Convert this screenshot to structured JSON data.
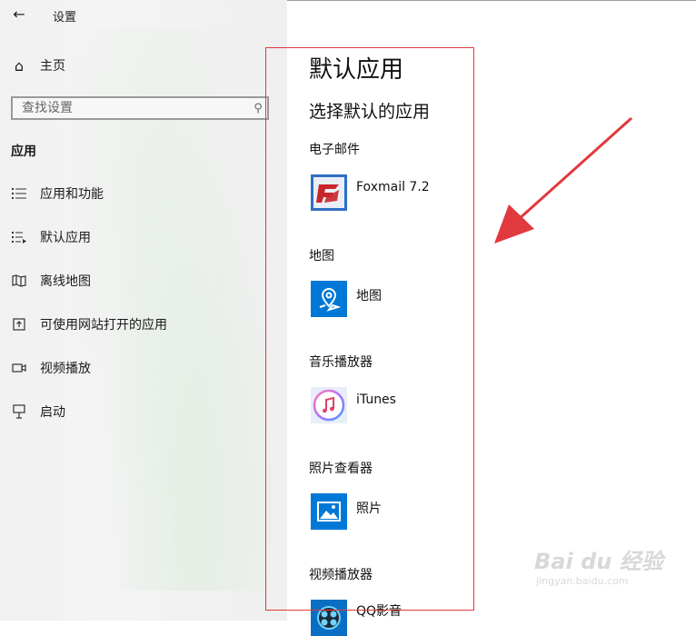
{
  "window": {
    "title": "设置",
    "back_icon": "back-arrow-icon"
  },
  "sidebar": {
    "home_label": "主页",
    "search_placeholder": "查找设置",
    "section_title": "应用",
    "items": [
      {
        "label": "应用和功能",
        "icon": "list-icon"
      },
      {
        "label": "默认应用",
        "icon": "default-apps-icon"
      },
      {
        "label": "离线地图",
        "icon": "offline-map-icon"
      },
      {
        "label": "可使用网站打开的应用",
        "icon": "open-window-icon"
      },
      {
        "label": "视频播放",
        "icon": "video-camera-icon"
      },
      {
        "label": "启动",
        "icon": "startup-icon"
      }
    ]
  },
  "main": {
    "title": "默认应用",
    "subtitle": "选择默认的应用",
    "categories": [
      {
        "label": "电子邮件",
        "app": "Foxmail 7.2",
        "icon": "foxmail-icon"
      },
      {
        "label": "地图",
        "app": "地图",
        "icon": "maps-icon"
      },
      {
        "label": "音乐播放器",
        "app": "iTunes",
        "icon": "itunes-icon"
      },
      {
        "label": "照片查看器",
        "app": "照片",
        "icon": "photos-icon"
      },
      {
        "label": "视频播放器",
        "app": "QQ影音",
        "icon": "qqplayer-icon"
      }
    ]
  },
  "watermark": {
    "brand": "Bai du 经验",
    "url": "jingyan.baidu.com"
  },
  "colors": {
    "accent": "#0078d7",
    "annotation_red": "#e0393e",
    "foxmail_red": "#c8262a"
  }
}
